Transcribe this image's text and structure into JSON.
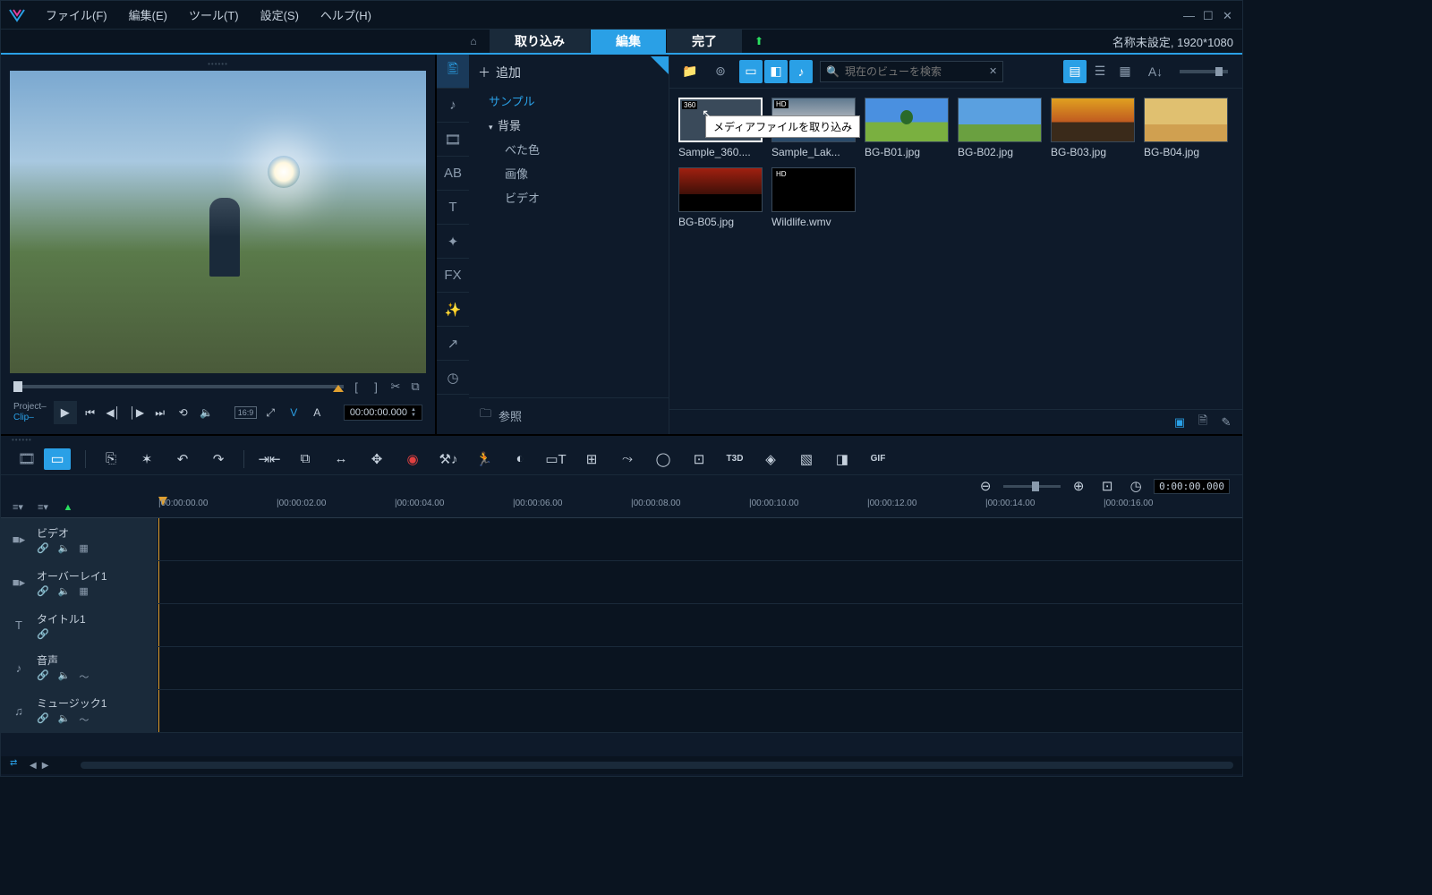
{
  "menubar": {
    "file": "ファイル(F)",
    "edit": "編集(E)",
    "tools": "ツール(T)",
    "settings": "設定(S)",
    "help": "ヘルプ(H)"
  },
  "tabs": {
    "import": "取り込み",
    "edit": "編集",
    "done": "完了"
  },
  "project_info": "名称未設定, 1920*1080",
  "preview": {
    "mode_project": "Project",
    "mode_clip": "Clip",
    "aspect": "16:9",
    "v_label": "V",
    "a_label": "A",
    "timecode": "00:00:00.000"
  },
  "library": {
    "add": "追加",
    "tree": {
      "sample": "サンプル",
      "background": "背景",
      "solid": "べた色",
      "image": "画像",
      "video": "ビデオ"
    },
    "browse": "参照",
    "search_placeholder": "現在のビューを検索",
    "tooltip": "メディアファイルを取り込み",
    "items": [
      {
        "label": "Sample_360....",
        "cls": "tb-360",
        "selected": true,
        "badge": "360"
      },
      {
        "label": "Sample_Lak...",
        "cls": "tb-lake",
        "badge": "HD"
      },
      {
        "label": "BG-B01.jpg",
        "cls": "tb-b01"
      },
      {
        "label": "BG-B02.jpg",
        "cls": "tb-b02"
      },
      {
        "label": "BG-B03.jpg",
        "cls": "tb-b03"
      },
      {
        "label": "BG-B04.jpg",
        "cls": "tb-b04"
      },
      {
        "label": "BG-B05.jpg",
        "cls": "tb-b05"
      },
      {
        "label": "Wildlife.wmv",
        "cls": "tb-wild",
        "badge": "HD"
      }
    ]
  },
  "timeline": {
    "timecode": "0:00:00.000",
    "ruler": [
      "00:00:00.00",
      "00:00:02.00",
      "00:00:04.00",
      "00:00:06.00",
      "00:00:08.00",
      "00:00:10.00",
      "00:00:12.00",
      "00:00:14.00",
      "00:00:16.00"
    ],
    "tracks": [
      {
        "name": "ビデオ",
        "icon": "■▸",
        "ctrls": [
          "🔗",
          "🔈",
          "▦"
        ]
      },
      {
        "name": "オーバーレイ1",
        "icon": "■▸",
        "ctrls": [
          "🔗",
          "🔈",
          "▦"
        ]
      },
      {
        "name": "タイトル1",
        "icon": "T",
        "ctrls": [
          "🔗"
        ]
      },
      {
        "name": "音声",
        "icon": "♪",
        "ctrls": [
          "🔗",
          "🔈",
          "～"
        ]
      },
      {
        "name": "ミュージック1",
        "icon": "♫",
        "ctrls": [
          "🔗",
          "🔈",
          "～"
        ]
      }
    ]
  },
  "fx_label": "FX",
  "t3d_label": "T3D",
  "gif_label": "GIF"
}
